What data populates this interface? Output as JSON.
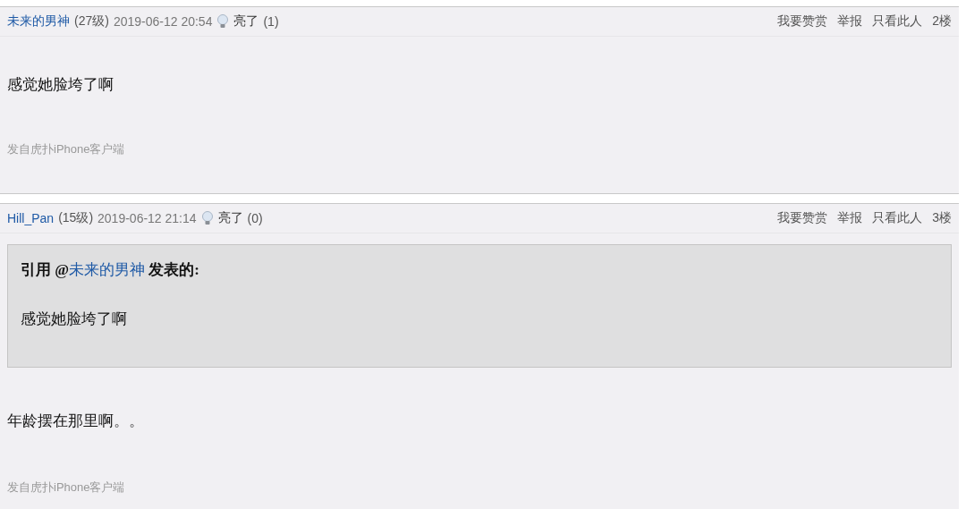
{
  "posts": [
    {
      "author": "未来的男神",
      "level": "(27级)",
      "time": "2019-06-12 20:54",
      "light_label": "亮了",
      "light_count": "(1)",
      "actions": [
        "我要赞赏",
        "举报",
        "只看此人"
      ],
      "floor": "2楼",
      "body": "感觉她脸垮了啊",
      "source": "发自虎扑iPhone客户端"
    },
    {
      "author": "Hill_Pan",
      "level": "(15级)",
      "time": "2019-06-12 21:14",
      "light_label": "亮了",
      "light_count": "(0)",
      "actions": [
        "我要赞赏",
        "举报",
        "只看此人"
      ],
      "floor": "3楼",
      "quote": {
        "lead": "引用 @",
        "user": "未来的男神",
        "tail": "发表的:",
        "text": "感觉她脸垮了啊"
      },
      "body": "年龄摆在那里啊。。",
      "source": "发自虎扑iPhone客户端"
    }
  ]
}
